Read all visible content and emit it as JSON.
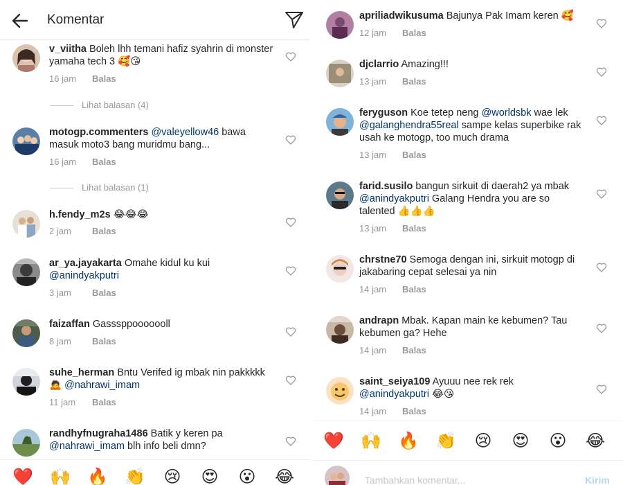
{
  "header": {
    "title": "Komentar"
  },
  "left_comments": [
    {
      "user": "v_viitha",
      "pre": " Boleh lhh temani hafiz syahrin di monster yamaha tech 3 ",
      "mention": "",
      "post": "",
      "emoji": "🥰😘",
      "time": "16 jam",
      "reply": "Balas",
      "view_replies": "Lihat balasan (4)"
    },
    {
      "user": "motogp.commenters",
      "pre": " ",
      "mention": "@valeyellow46",
      "post": " bawa masuk moto3 bang muridmu bang...",
      "emoji": "",
      "time": "16 jam",
      "reply": "Balas",
      "view_replies": "Lihat balasan (1)"
    },
    {
      "user": "h.fendy_m2s",
      "pre": " ",
      "mention": "",
      "post": "",
      "emoji": "😂😂😂",
      "time": "2 jam",
      "reply": "Balas",
      "view_replies": ""
    },
    {
      "user": "ar_ya.jayakarta",
      "pre": " Omahe kidul ku kui ",
      "mention": "@anindyakputri",
      "post": "",
      "emoji": "",
      "time": "3 jam",
      "reply": "Balas",
      "view_replies": ""
    },
    {
      "user": "faizaffan",
      "pre": " Gasssppooooooll",
      "mention": "",
      "post": "",
      "emoji": "",
      "time": "8 jam",
      "reply": "Balas",
      "view_replies": ""
    },
    {
      "user": "suhe_herman",
      "pre": " Bntu Verifed ig mbak nin pakkkkk ",
      "mention": "@nahrawi_imam",
      "post": "",
      "emoji": "🙇",
      "time": "11 jam",
      "reply": "Balas",
      "view_replies": ""
    },
    {
      "user": "randhyfnugraha1486",
      "pre": " Batik y keren pa ",
      "mention": "@nahrawi_imam",
      "post": " blh info beli dmn?",
      "emoji": "",
      "time": "",
      "reply": "",
      "view_replies": ""
    }
  ],
  "right_comments": [
    {
      "user": "apriliadwikusuma",
      "pre": " Bajunya Pak Imam keren ",
      "mention": "",
      "post": "",
      "emoji": "🥰",
      "time": "12 jam",
      "reply": "Balas"
    },
    {
      "user": "djclarrio",
      "pre": " Amazing!!!",
      "mention": "",
      "post": "",
      "emoji": "",
      "time": "13 jam",
      "reply": "Balas"
    },
    {
      "user": "feryguson",
      "pre": " Koe tetep neng ",
      "mention": "@worldsbk",
      "post": " wae lek ",
      "mention2": "@galanghendra55real",
      "post2": " sampe kelas superbike rak usah ke motogp, too much drama",
      "emoji": "",
      "time": "13 jam",
      "reply": "Balas"
    },
    {
      "user": "farid.susilo",
      "pre": " bangun sirkuit di daerah2 ya mbak ",
      "mention": "@anindyakputri",
      "post": "  Galang Hendra you are so talented ",
      "emoji": "👍👍👍",
      "time": "13 jam",
      "reply": "Balas"
    },
    {
      "user": "chrstne70",
      "pre": " Semoga dengan ini, sirkuit motogp di jakabaring cepat selesai ya nin",
      "mention": "",
      "post": "",
      "emoji": "",
      "time": "14 jam",
      "reply": "Balas"
    },
    {
      "user": "andrapn",
      "pre": " Mbak. Kapan main ke kebumen? Tau kebumen ga? Hehe",
      "mention": "",
      "post": "",
      "emoji": "",
      "time": "14 jam",
      "reply": "Balas"
    },
    {
      "user": "saint_seiya109",
      "pre": " Ayuuu nee rek rek ",
      "mention": "@anindyakputri",
      "post": " ",
      "emoji": "😂😘",
      "time": "14 jam",
      "reply": "Balas"
    }
  ],
  "emoji_bar": [
    "❤️",
    "🙌",
    "🔥",
    "👏",
    "😢",
    "😍",
    "😮",
    "😂"
  ],
  "input": {
    "placeholder": "Tambahkan komentar...",
    "post_label": "Kirim"
  },
  "colors": {
    "mention": "#003569",
    "meta": "#999999",
    "heart_red": "#ed4956"
  },
  "icons": {
    "back": "arrow-left-icon",
    "send": "paper-plane-icon",
    "like": "heart-outline-icon"
  }
}
